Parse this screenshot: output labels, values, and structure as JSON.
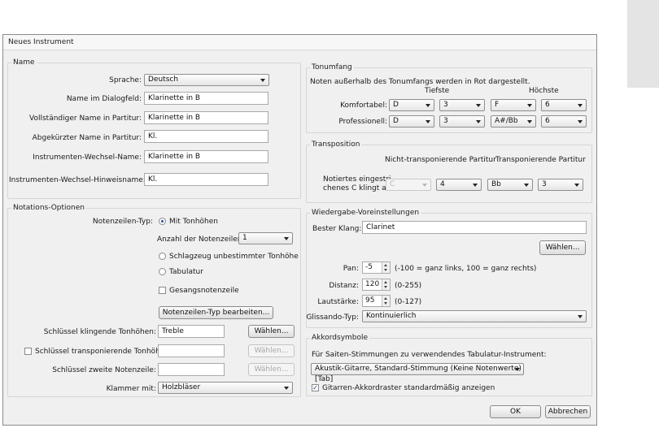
{
  "window": {
    "title": "Neues Instrument"
  },
  "name_group": {
    "title": "Name",
    "language_label": "Sprache:",
    "language_value": "Deutsch",
    "dialog_name_label": "Name im Dialogfeld:",
    "dialog_name_value": "Klarinette in B",
    "full_name_label": "Vollständiger Name in Partitur:",
    "full_name_value": "Klarinette in B",
    "short_name_label": "Abgekürzter Name in Partitur:",
    "short_name_value": "Kl.",
    "change_name_label": "Instrumenten-Wechsel-Name:",
    "change_name_value": "Klarinette in B",
    "change_hint_label": "Instrumenten-Wechsel-Hinweisname:",
    "change_hint_value": "Kl."
  },
  "notation_group": {
    "title": "Notations-Optionen",
    "staff_type_label": "Notenzeilen-Typ:",
    "pitched_label": "Mit Tonhöhen",
    "num_staves_label": "Anzahl der Notenzeilen:",
    "num_staves_value": "1",
    "percussion_label": "Schlagzeug unbestimmter Tonhöhe",
    "tablature_label": "Tabulatur",
    "vocal_label": "Gesangsnotenzeile",
    "edit_staff_type_button": "Notenzeilen-Typ bearbeiten...",
    "clef_concert_label": "Schlüssel klingende Tonhöhen:",
    "clef_concert_value": "Treble",
    "clef_transposing_label": "Schlüssel transponierende Tonhöhen:",
    "clef_transposing_value": "",
    "clef_second_label": "Schlüssel zweite Notenzeile:",
    "clef_second_value": "",
    "choose_button": "Wählen...",
    "bracket_label": "Klammer mit:",
    "bracket_value": "Holzbläser"
  },
  "range_group": {
    "title": "Tonumfang",
    "description": "Noten außerhalb des Tonumfangs werden in Rot dargestellt.",
    "lowest_header": "Tiefste",
    "highest_header": "Höchste",
    "comfortable_label": "Komfortabel:",
    "comfortable": [
      "D",
      "3",
      "F",
      "6"
    ],
    "professional_label": "Professionell:",
    "professional": [
      "D",
      "3",
      "A#/Bb",
      "6"
    ]
  },
  "transposition_group": {
    "title": "Transposition",
    "non_transposing_header": "Nicht-transponierende Partitur",
    "transposing_header": "Transponierende Partitur",
    "written_c_label_1": "Notiertes eingestri-",
    "written_c_label_2": "chenes C klingt als:",
    "values": [
      "C",
      "4",
      "Bb",
      "3"
    ]
  },
  "playback_group": {
    "title": "Wiedergabe-Voreinstellungen",
    "best_sound_label": "Bester Klang:",
    "best_sound_value": "Clarinet",
    "choose_button": "Wählen...",
    "pan_label": "Pan:",
    "pan_value": "-5",
    "pan_hint": "(-100 = ganz links, 100 = ganz rechts)",
    "distance_label": "Distanz:",
    "distance_value": "120",
    "distance_hint": "(0-255)",
    "volume_label": "Lautstärke:",
    "volume_value": "95",
    "volume_hint": "(0-127)",
    "gliss_label": "Glissando-Typ:",
    "gliss_value": "Kontinuierlich"
  },
  "chord_group": {
    "title": "Akkordsymbole",
    "tab_instrument_label": "Für Saiten-Stimmungen zu verwendendes Tabulatur-Instrument:",
    "tab_instrument_value": "Akustik-Gitarre, Standard-Stimmung (Keine Notenwerte) [Tab]",
    "guitar_grid_label": "Gitarren-Akkordraster standardmäßig anzeigen"
  },
  "buttons": {
    "ok": "OK",
    "cancel": "Abbrechen"
  }
}
